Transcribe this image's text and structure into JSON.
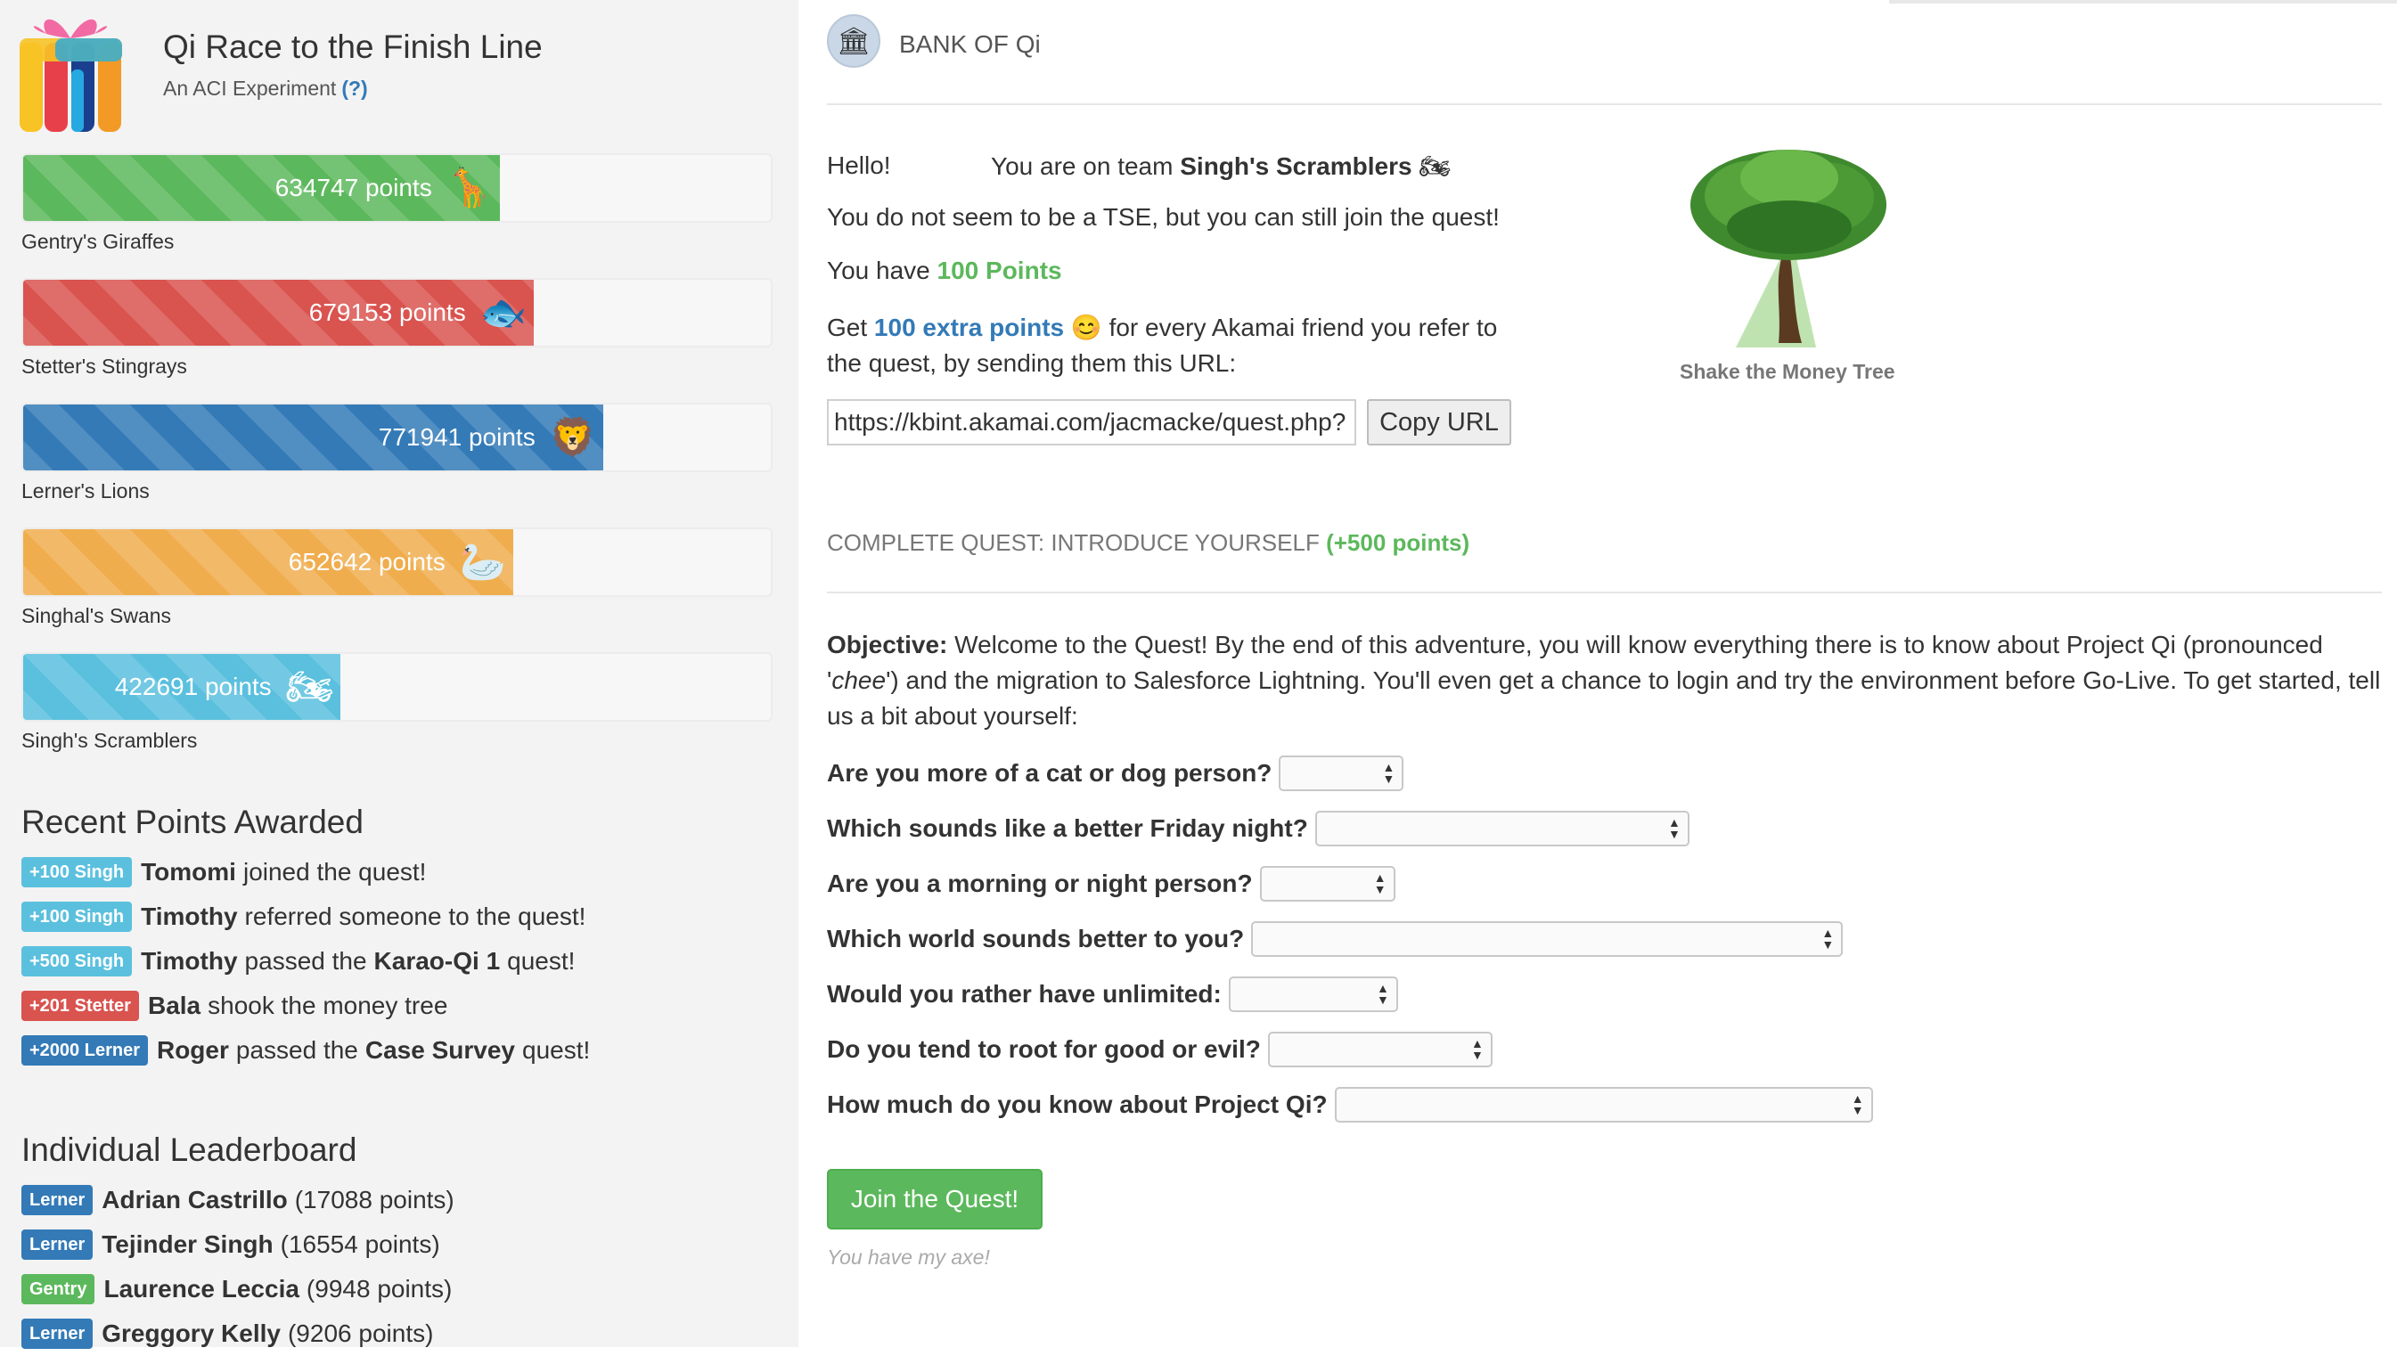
{
  "app": {
    "title": "Qi Race to the Finish Line",
    "subtitle": "An ACI Experiment",
    "help": "(?)"
  },
  "teams": [
    {
      "points_text": "634747 points",
      "points": 634747,
      "name": "Gentry's Giraffes",
      "color": "#5cb85c",
      "icon": "giraffe-icon",
      "glyph": "🦒"
    },
    {
      "points_text": "679153 points",
      "points": 679153,
      "name": "Stetter's Stingrays",
      "color": "#d9534f",
      "icon": "stingray-icon",
      "glyph": "🐟"
    },
    {
      "points_text": "771941 points",
      "points": 771941,
      "name": "Lerner's Lions",
      "color": "#337ab7",
      "icon": "lion-icon",
      "glyph": "🦁"
    },
    {
      "points_text": "652642 points",
      "points": 652642,
      "name": "Singhal's Swans",
      "color": "#f0ad4e",
      "icon": "swan-icon",
      "glyph": "🦢"
    },
    {
      "points_text": "422691 points",
      "points": 422691,
      "name": "Singh's Scramblers",
      "color": "#5bc0de",
      "icon": "motorcycle-icon",
      "glyph": "🏍"
    }
  ],
  "recent": {
    "title": "Recent Points Awarded",
    "items": [
      {
        "badge": "+100 Singh",
        "name": "Tomomi",
        "text": "joined the quest!"
      },
      {
        "badge": "+100 Singh",
        "name": "Timothy",
        "text": "referred someone to the quest!"
      },
      {
        "badge": "+500 Singh",
        "name": "Timothy",
        "text": "passed the Karao-Qi 1 quest!",
        "pre": "passed the",
        "quest": "Karao-Qi 1",
        "post": "quest!"
      },
      {
        "badge": "+201 Stetter",
        "name": "Bala",
        "text": "shook the money tree"
      },
      {
        "badge": "+2000 Lerner",
        "name": "Roger",
        "pre": "passed the",
        "quest": "Case Survey",
        "post": "quest!"
      }
    ]
  },
  "leaderboard": {
    "title": "Individual Leaderboard",
    "items": [
      {
        "badge": "Lerner",
        "name": "Adrian Castrillo",
        "points": "(17088 points)"
      },
      {
        "badge": "Lerner",
        "name": "Tejinder Singh",
        "points": "(16554 points)"
      },
      {
        "badge": "Gentry",
        "name": "Laurence Leccia",
        "points": "(9948 points)"
      },
      {
        "badge": "Lerner",
        "name": "Greggory Kelly",
        "points": "(9206 points)"
      }
    ]
  },
  "bank": {
    "name": "BANK OF Qi"
  },
  "welcome": {
    "hello": "Hello!",
    "team_prefix": "You are on team",
    "team_name": "Singh's Scramblers",
    "tse_text": "You do not seem to be a TSE, but you can still join the quest!",
    "have_prefix": "You have",
    "points": "100 Points",
    "refer_get": "Get",
    "refer_extra": "100 extra points",
    "refer_rest": "for every Akamai friend you refer to the quest, by sending them this URL:",
    "url": "https://kbint.akamai.com/jacmacke/quest.php?",
    "copy": "Copy URL",
    "tree_caption": "Shake the Money Tree"
  },
  "quest": {
    "title": "COMPLETE QUEST: INTRODUCE YOURSELF",
    "bonus": "(+500 points)",
    "objective_label": "Objective:",
    "objective_a": "Welcome to the Quest! By the end of this adventure, you will know everything there is to know about Project Qi (pronounced '",
    "objective_chee": "chee",
    "objective_b": "') and the migration to Salesforce Lightning. You'll even get a chance to login and try the environment before Go-Live. To get started, tell us a bit about yourself:",
    "questions": [
      "Are you more of a cat or dog person?",
      "Which sounds like a better Friday night?",
      "Are you a morning or night person?",
      "Which world sounds better to you?",
      "Would you rather have unlimited:",
      "Do you tend to root for good or evil?",
      "How much do you know about Project Qi?"
    ],
    "join": "Join the Quest!",
    "footer": "You have my axe!"
  }
}
